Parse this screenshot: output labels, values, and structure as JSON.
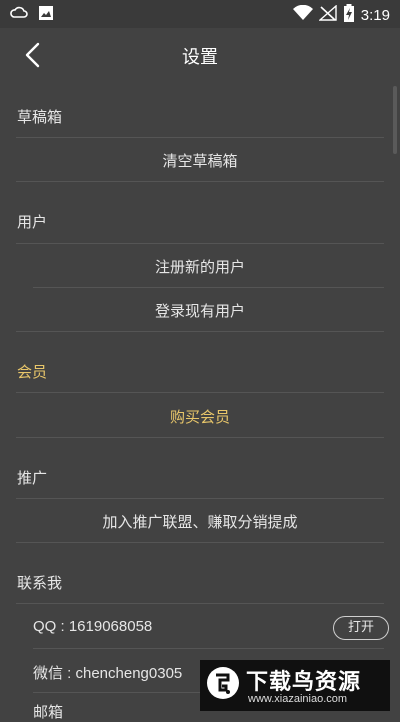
{
  "statusbar": {
    "time": "3:19",
    "icons_left": [
      "cloud-icon",
      "image-icon"
    ],
    "icons_right": [
      "wifi-icon",
      "no-signal-icon",
      "battery-charging-icon"
    ]
  },
  "header": {
    "title": "设置",
    "back_icon": "chevron-left-icon"
  },
  "sections": {
    "drafts": {
      "title": "草稿箱",
      "items": [
        "清空草稿箱"
      ]
    },
    "user": {
      "title": "用户",
      "items": [
        "注册新的用户",
        "登录现有用户"
      ]
    },
    "membership": {
      "title": "会员",
      "items": [
        "购买会员"
      ]
    },
    "promotion": {
      "title": "推广",
      "items": [
        "加入推广联盟、赚取分销提成"
      ]
    },
    "contact": {
      "title": "联系我",
      "qq": "QQ : 1619068058",
      "qq_button": "打开",
      "wechat": "微信 : chencheng0305",
      "email_partial": "邮箱"
    }
  },
  "watermark": {
    "title": "下载鸟资源",
    "url": "www.xiazainiao.com"
  },
  "colors": {
    "background": "#424242",
    "accent_gold": "#e8c66a",
    "text": "#e6e6e6",
    "divider": "#555555"
  }
}
